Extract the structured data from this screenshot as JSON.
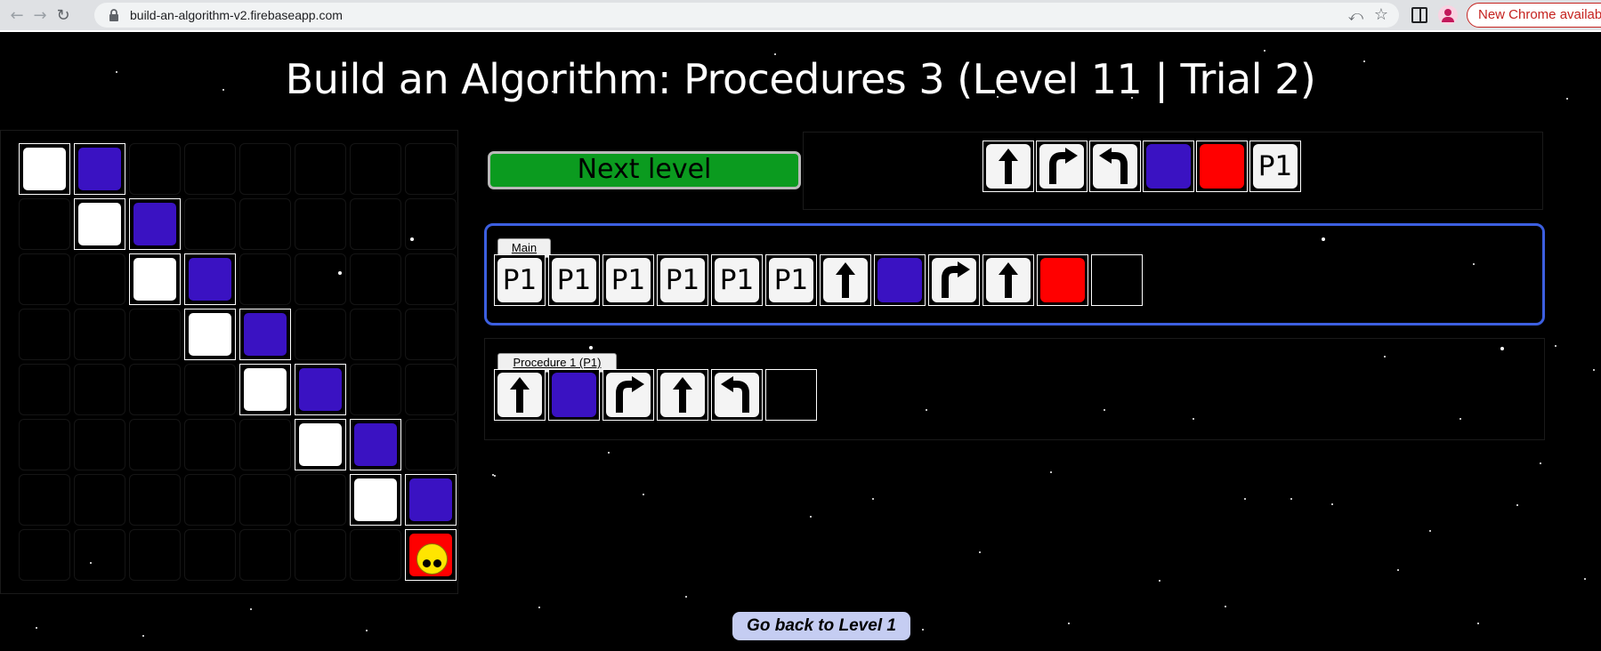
{
  "browser": {
    "url": "build-an-algorithm-v2.firebaseapp.com",
    "update_label": "New Chrome availab"
  },
  "game": {
    "title": "Build an Algorithm: Procedures 3 (Level 11 | Trial 2)",
    "next_level_label": "Next level",
    "back_label": "Go back to Level 1",
    "palette": [
      {
        "kind": "forward",
        "label": ""
      },
      {
        "kind": "turn-right",
        "label": ""
      },
      {
        "kind": "turn-left",
        "label": ""
      },
      {
        "kind": "blue",
        "label": ""
      },
      {
        "kind": "red",
        "label": ""
      },
      {
        "kind": "proc",
        "label": "P1"
      }
    ],
    "main": {
      "label": "Main",
      "steps": [
        {
          "kind": "proc",
          "label": "P1"
        },
        {
          "kind": "proc",
          "label": "P1"
        },
        {
          "kind": "proc",
          "label": "P1"
        },
        {
          "kind": "proc",
          "label": "P1"
        },
        {
          "kind": "proc",
          "label": "P1"
        },
        {
          "kind": "proc",
          "label": "P1"
        },
        {
          "kind": "forward",
          "label": ""
        },
        {
          "kind": "blue",
          "label": ""
        },
        {
          "kind": "turn-right",
          "label": ""
        },
        {
          "kind": "forward",
          "label": ""
        },
        {
          "kind": "red",
          "label": ""
        },
        {
          "kind": "empty",
          "label": ""
        }
      ]
    },
    "procedure1": {
      "label": "Procedure 1 (P1)",
      "steps": [
        {
          "kind": "forward",
          "label": ""
        },
        {
          "kind": "blue",
          "label": ""
        },
        {
          "kind": "turn-right",
          "label": ""
        },
        {
          "kind": "forward",
          "label": ""
        },
        {
          "kind": "turn-left",
          "label": ""
        },
        {
          "kind": "empty",
          "label": ""
        }
      ]
    },
    "board": {
      "size": 8,
      "cells": [
        {
          "row": 0,
          "col": 0,
          "color": "white"
        },
        {
          "row": 0,
          "col": 1,
          "color": "blue"
        },
        {
          "row": 1,
          "col": 1,
          "color": "white"
        },
        {
          "row": 1,
          "col": 2,
          "color": "blue"
        },
        {
          "row": 2,
          "col": 2,
          "color": "white"
        },
        {
          "row": 2,
          "col": 3,
          "color": "blue"
        },
        {
          "row": 3,
          "col": 3,
          "color": "white"
        },
        {
          "row": 3,
          "col": 4,
          "color": "blue"
        },
        {
          "row": 4,
          "col": 4,
          "color": "white"
        },
        {
          "row": 4,
          "col": 5,
          "color": "blue"
        },
        {
          "row": 5,
          "col": 5,
          "color": "white"
        },
        {
          "row": 5,
          "col": 6,
          "color": "blue"
        },
        {
          "row": 6,
          "col": 6,
          "color": "white"
        },
        {
          "row": 6,
          "col": 7,
          "color": "blue"
        },
        {
          "row": 7,
          "col": 7,
          "color": "red",
          "robot": true
        }
      ]
    },
    "colors": {
      "blue": "#3a12c2",
      "red": "#ff0000",
      "white": "#ffffff",
      "next_green": "#0b9b1f",
      "main_border": "#3c5fe0"
    }
  }
}
